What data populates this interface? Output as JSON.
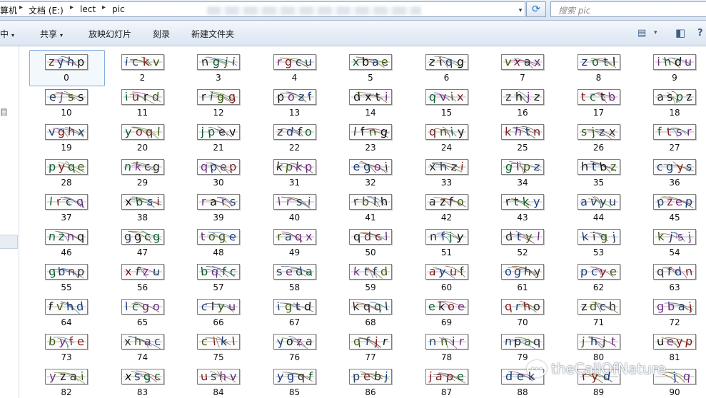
{
  "address": {
    "crumbs": [
      "算机",
      "文档 (E:)",
      "lect",
      "pic"
    ],
    "separators": [
      "▸",
      "▸",
      "▸"
    ],
    "dropdown": "▾",
    "refresh": "⟳"
  },
  "search": {
    "placeholder": "搜索 pic"
  },
  "toolbar": {
    "include": "中",
    "share": "共享",
    "slideshow": "放映幻灯片",
    "burn": "刻录",
    "new_folder": "新建文件夹",
    "arrow": "▾",
    "view_icon": "▤",
    "preview_icon": "◧",
    "help_icon": "?"
  },
  "nav": {
    "mark": "目"
  },
  "colors": {
    "accent": "#2c6fc4",
    "selection": "#84acdd"
  },
  "files": [
    {
      "label": "0",
      "chars": [
        "z",
        "y",
        "h",
        "p"
      ]
    },
    {
      "label": "2",
      "chars": [
        "i",
        "c",
        "k",
        "v"
      ]
    },
    {
      "label": "3",
      "chars": [
        "n",
        "g",
        "j",
        "i"
      ]
    },
    {
      "label": "4",
      "chars": [
        "r",
        "g",
        "c",
        "u"
      ]
    },
    {
      "label": "5",
      "chars": [
        "x",
        "b",
        "a",
        "e"
      ]
    },
    {
      "label": "6",
      "chars": [
        "z",
        "i",
        "q",
        "g"
      ]
    },
    {
      "label": "7",
      "chars": [
        "v",
        "x",
        "a",
        "x"
      ]
    },
    {
      "label": "8",
      "chars": [
        "z",
        "o",
        "t",
        "l"
      ]
    },
    {
      "label": "9",
      "chars": [
        "i",
        "h",
        "d",
        "u"
      ]
    },
    {
      "label": "10",
      "chars": [
        "e",
        "j",
        "s",
        "s"
      ]
    },
    {
      "label": "11",
      "chars": [
        "i",
        "u",
        "r",
        "d"
      ]
    },
    {
      "label": "12",
      "chars": [
        "r",
        "i",
        "g",
        "g"
      ]
    },
    {
      "label": "13",
      "chars": [
        "p",
        "o",
        "z",
        "f"
      ]
    },
    {
      "label": "14",
      "chars": [
        "d",
        "x",
        "t",
        "i"
      ]
    },
    {
      "label": "15",
      "chars": [
        "q",
        "v",
        "i",
        "x"
      ]
    },
    {
      "label": "16",
      "chars": [
        "z",
        "h",
        "j",
        "z"
      ]
    },
    {
      "label": "17",
      "chars": [
        "t",
        "c",
        "t",
        "b"
      ]
    },
    {
      "label": "18",
      "chars": [
        "a",
        "s",
        "p",
        "z"
      ]
    },
    {
      "label": "19",
      "chars": [
        "v",
        "g",
        "h",
        "x"
      ]
    },
    {
      "label": "20",
      "chars": [
        "y",
        "o",
        "q",
        "l"
      ]
    },
    {
      "label": "21",
      "chars": [
        "j",
        "p",
        "e",
        "v"
      ]
    },
    {
      "label": "22",
      "chars": [
        "z",
        "d",
        "f",
        "o"
      ]
    },
    {
      "label": "23",
      "chars": [
        "l",
        "f",
        "n",
        "g"
      ]
    },
    {
      "label": "24",
      "chars": [
        "q",
        "n",
        "i",
        "y"
      ]
    },
    {
      "label": "25",
      "chars": [
        "k",
        "h",
        "t",
        "n"
      ]
    },
    {
      "label": "26",
      "chars": [
        "s",
        "j",
        "z",
        "x"
      ]
    },
    {
      "label": "27",
      "chars": [
        "f",
        "t",
        "s",
        "r"
      ]
    },
    {
      "label": "28",
      "chars": [
        "p",
        "y",
        "q",
        "e"
      ]
    },
    {
      "label": "29",
      "chars": [
        "n",
        "k",
        "c",
        "g"
      ]
    },
    {
      "label": "30",
      "chars": [
        "q",
        "p",
        "e",
        "p"
      ]
    },
    {
      "label": "31",
      "chars": [
        "k",
        "p",
        "k",
        "p"
      ]
    },
    {
      "label": "32",
      "chars": [
        "e",
        "g",
        "o",
        "i"
      ]
    },
    {
      "label": "33",
      "chars": [
        "x",
        "h",
        "z",
        "i"
      ]
    },
    {
      "label": "34",
      "chars": [
        "g",
        "i",
        "p",
        "z"
      ]
    },
    {
      "label": "35",
      "chars": [
        "h",
        "t",
        "b",
        "z"
      ]
    },
    {
      "label": "36",
      "chars": [
        "c",
        "g",
        "y",
        "s"
      ]
    },
    {
      "label": "37",
      "chars": [
        "l",
        "r",
        "c",
        "q"
      ]
    },
    {
      "label": "38",
      "chars": [
        "x",
        "b",
        "s",
        "i"
      ]
    },
    {
      "label": "39",
      "chars": [
        "r",
        "a",
        "r",
        "s"
      ]
    },
    {
      "label": "40",
      "chars": [
        "l",
        "r",
        "s",
        "i"
      ]
    },
    {
      "label": "41",
      "chars": [
        "r",
        "b",
        "l",
        "h"
      ]
    },
    {
      "label": "42",
      "chars": [
        "a",
        "z",
        "f",
        "o"
      ]
    },
    {
      "label": "43",
      "chars": [
        "r",
        "t",
        "k",
        "y"
      ]
    },
    {
      "label": "44",
      "chars": [
        "a",
        "v",
        "y",
        "u"
      ]
    },
    {
      "label": "45",
      "chars": [
        "p",
        "z",
        "e",
        "p"
      ]
    },
    {
      "label": "46",
      "chars": [
        "n",
        "z",
        "n",
        "q"
      ]
    },
    {
      "label": "47",
      "chars": [
        "g",
        "g",
        "c",
        "g"
      ]
    },
    {
      "label": "48",
      "chars": [
        "t",
        "o",
        "g",
        "e"
      ]
    },
    {
      "label": "49",
      "chars": [
        "r",
        "a",
        "q",
        "x"
      ]
    },
    {
      "label": "50",
      "chars": [
        "q",
        "d",
        "c",
        "l"
      ]
    },
    {
      "label": "51",
      "chars": [
        "n",
        "f",
        "j",
        "y"
      ]
    },
    {
      "label": "52",
      "chars": [
        "d",
        "t",
        "y",
        "l"
      ]
    },
    {
      "label": "53",
      "chars": [
        "k",
        "i",
        "g",
        "j"
      ]
    },
    {
      "label": "54",
      "chars": [
        "k",
        "j",
        "s",
        "j"
      ]
    },
    {
      "label": "55",
      "chars": [
        "g",
        "b",
        "n",
        "p"
      ]
    },
    {
      "label": "56",
      "chars": [
        "x",
        "f",
        "z",
        "u"
      ]
    },
    {
      "label": "57",
      "chars": [
        "b",
        "q",
        "f",
        "c"
      ]
    },
    {
      "label": "58",
      "chars": [
        "s",
        "e",
        "d",
        "a"
      ]
    },
    {
      "label": "59",
      "chars": [
        "k",
        "t",
        "f",
        "d"
      ]
    },
    {
      "label": "60",
      "chars": [
        "a",
        "y",
        "u",
        "f"
      ]
    },
    {
      "label": "61",
      "chars": [
        "o",
        "g",
        "h",
        "y"
      ]
    },
    {
      "label": "62",
      "chars": [
        "p",
        "c",
        "y",
        "e"
      ]
    },
    {
      "label": "63",
      "chars": [
        "q",
        "f",
        "d",
        "n"
      ]
    },
    {
      "label": "64",
      "chars": [
        "f",
        "v",
        "h",
        "d"
      ]
    },
    {
      "label": "65",
      "chars": [
        "l",
        "c",
        "g",
        "o"
      ]
    },
    {
      "label": "66",
      "chars": [
        "c",
        "l",
        "y",
        "u"
      ]
    },
    {
      "label": "67",
      "chars": [
        "i",
        "g",
        "t",
        "d"
      ]
    },
    {
      "label": "68",
      "chars": [
        "k",
        "q",
        "q",
        "l"
      ]
    },
    {
      "label": "69",
      "chars": [
        "e",
        "k",
        "o",
        "e"
      ]
    },
    {
      "label": "70",
      "chars": [
        "q",
        "r",
        "h",
        "o"
      ]
    },
    {
      "label": "71",
      "chars": [
        "z",
        "d",
        "c",
        "h"
      ]
    },
    {
      "label": "72",
      "chars": [
        "g",
        "b",
        "a",
        "j"
      ]
    },
    {
      "label": "73",
      "chars": [
        "b",
        "y",
        "f",
        "e"
      ]
    },
    {
      "label": "74",
      "chars": [
        "x",
        "h",
        "a",
        "c"
      ]
    },
    {
      "label": "75",
      "chars": [
        "c",
        "i",
        "k",
        "l"
      ]
    },
    {
      "label": "76",
      "chars": [
        "y",
        "o",
        "z",
        "a"
      ]
    },
    {
      "label": "77",
      "chars": [
        "q",
        "f",
        "j",
        "r"
      ]
    },
    {
      "label": "78",
      "chars": [
        "n",
        "n",
        "i",
        "r"
      ]
    },
    {
      "label": "79",
      "chars": [
        "n",
        "p",
        "a",
        "q"
      ]
    },
    {
      "label": "80",
      "chars": [
        "j",
        "h",
        "j",
        "t"
      ]
    },
    {
      "label": "81",
      "chars": [
        "u",
        "e",
        "y",
        "p"
      ]
    },
    {
      "label": "82",
      "chars": [
        "y",
        "z",
        "a",
        "i"
      ]
    },
    {
      "label": "83",
      "chars": [
        "x",
        "s",
        "g",
        "c"
      ]
    },
    {
      "label": "84",
      "chars": [
        "u",
        "s",
        "h",
        "v"
      ]
    },
    {
      "label": "85",
      "chars": [
        "y",
        "g",
        "q",
        "f"
      ]
    },
    {
      "label": "86",
      "chars": [
        "p",
        "e",
        "b",
        "j"
      ]
    },
    {
      "label": "87",
      "chars": [
        "j",
        "a",
        "p",
        "e"
      ]
    },
    {
      "label": "88",
      "chars": [
        "d",
        "e",
        "k",
        ""
      ]
    },
    {
      "label": "89",
      "chars": [
        "r",
        "y",
        "d",
        ""
      ]
    },
    {
      "label": "90",
      "chars": [
        "",
        "",
        "j",
        "q"
      ]
    }
  ],
  "watermark": {
    "text": "theCallOfNature",
    "icon": "chat-bubble-icon"
  }
}
